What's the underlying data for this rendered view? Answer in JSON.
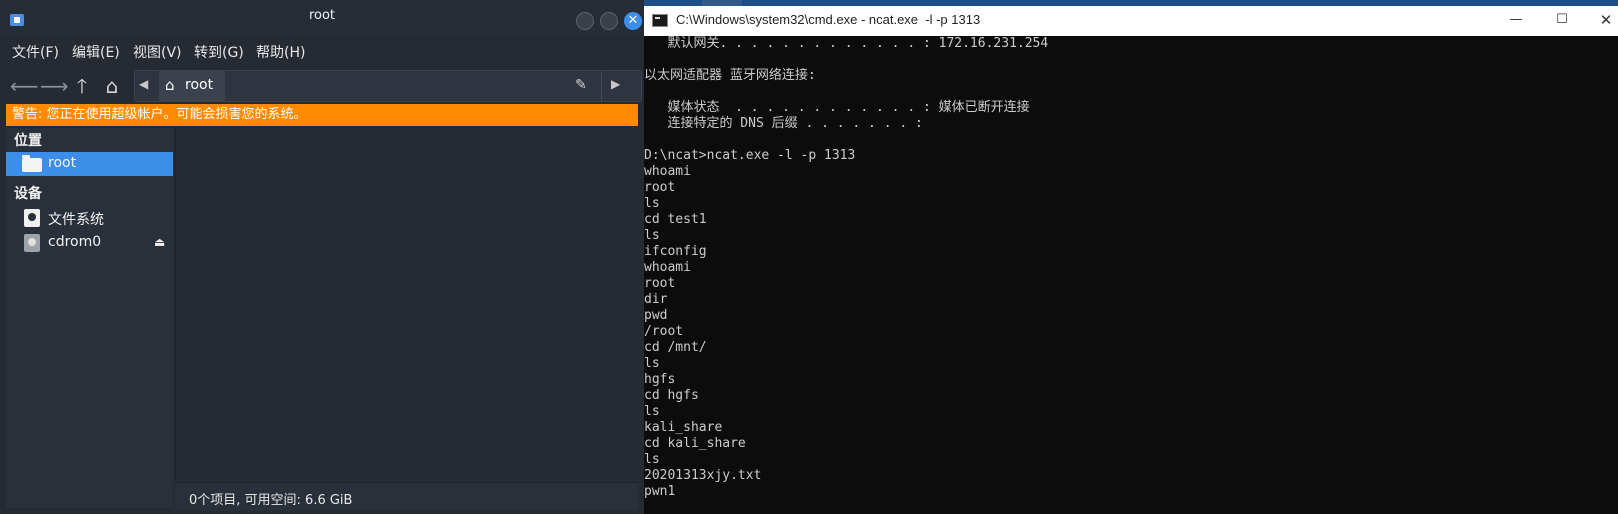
{
  "file_manager": {
    "title": "root",
    "close_glyph": "✕",
    "menu": [
      "文件(F)",
      "编辑(E)",
      "视图(V)",
      "转到(G)",
      "帮助(H)"
    ],
    "path": {
      "current": "root"
    },
    "warning": "警告: 您正在使用超级帐户。可能会损害您的系统。",
    "sidebar": {
      "places_header": "位置",
      "places": [
        {
          "label": "root",
          "icon": "folder-icon",
          "selected": true
        }
      ],
      "devices_header": "设备",
      "devices": [
        {
          "label": "文件系统",
          "icon": "drive-icon"
        },
        {
          "label": "cdrom0",
          "icon": "cdrom-icon"
        }
      ]
    },
    "status": "0个项目, 可用空间: 6.6 GiB"
  },
  "cmd_window": {
    "title": "C:\\Windows\\system32\\cmd.exe - ncat.exe  -l -p 1313",
    "controls": {
      "minimize": "—",
      "maximize": "☐",
      "close": "✕"
    },
    "lines": [
      "   默认网关. . . . . . . . . . . . . : 172.16.231.254",
      "",
      "以太网适配器 蓝牙网络连接:",
      "",
      "   媒体状态  . . . . . . . . . . . . : 媒体已断开连接",
      "   连接特定的 DNS 后缀 . . . . . . . :",
      "",
      "D:\\ncat>ncat.exe -l -p 1313",
      "whoami",
      "root",
      "ls",
      "cd test1",
      "ls",
      "ifconfig",
      "whoami",
      "root",
      "dir",
      "pwd",
      "/root",
      "cd /mnt/",
      "ls",
      "hgfs",
      "cd hgfs",
      "ls",
      "kali_share",
      "cd kali_share",
      "ls",
      "20201313xjy.txt",
      "pwn1"
    ]
  },
  "colors": {
    "warning_bg": "#ff8a00",
    "selection_bg": "#3d8ee8",
    "console_bg": "#0c0c0c",
    "console_fg": "#cccccc"
  }
}
